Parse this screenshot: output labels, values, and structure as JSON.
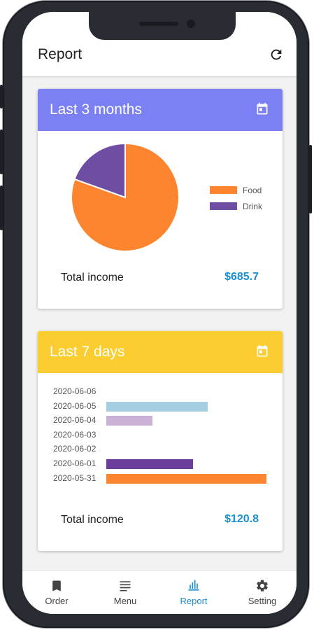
{
  "app": {
    "title": "Report"
  },
  "header": {
    "title": "Report",
    "refresh_icon": "refresh-icon"
  },
  "cards": {
    "months": {
      "title": "Last 3 months",
      "header_color": "#7b80f3",
      "icon": "calendar-icon",
      "total_label": "Total income",
      "total_value": "$685.7"
    },
    "days": {
      "title": "Last 7 days",
      "header_color": "#fccd30",
      "icon": "calendar-icon",
      "total_label": "Total income",
      "total_value": "$120.8"
    }
  },
  "accent_color": "#1a8fd0",
  "chart_data": [
    {
      "type": "pie",
      "title": "",
      "legend_position": "right",
      "series": [
        {
          "name": "Food",
          "value": 0.805,
          "color": "#fd8530"
        },
        {
          "name": "Drink",
          "value": 0.195,
          "color": "#6e4ea3"
        }
      ]
    },
    {
      "type": "bar",
      "orientation": "horizontal",
      "title": "",
      "categories": [
        "2020-06-06",
        "2020-06-05",
        "2020-06-04",
        "2020-06-03",
        "2020-06-02",
        "2020-06-01",
        "2020-05-31"
      ],
      "values": [
        0,
        0.635,
        0.29,
        0,
        0,
        0.54,
        1.0
      ],
      "colors": [
        "#a6cee3",
        "#a6cee3",
        "#cab2d6",
        "#a6cee3",
        "#a6cee3",
        "#6a3d9a",
        "#fd8530"
      ]
    }
  ],
  "bottom_nav": {
    "items": [
      {
        "label": "Order",
        "icon": "bookmark-icon",
        "active": false
      },
      {
        "label": "Menu",
        "icon": "menu-icon",
        "active": false
      },
      {
        "label": "Report",
        "icon": "bar-chart-icon",
        "active": true
      },
      {
        "label": "Setting",
        "icon": "gear-icon",
        "active": false
      }
    ],
    "active_color": "#1a8fd0",
    "inactive_color": "#444444"
  }
}
